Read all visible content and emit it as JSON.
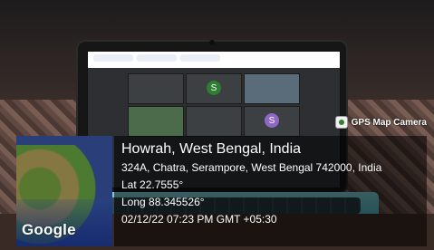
{
  "overlay": {
    "badge": {
      "text": "GPS Map Camera",
      "icon": "gps-map-camera-icon"
    },
    "map": {
      "brand_text": "Google"
    },
    "location": {
      "title": "Howrah, West Bengal, India",
      "address": "324A, Chatra, Serampore, West Bengal 742000, India",
      "lat": "Lat 22.7555°",
      "long": "Long 88.345526°",
      "timestamp": "02/12/22 07:23 PM GMT +05:30"
    }
  },
  "screen": {
    "tiles": [
      {
        "kind": "avatar",
        "label": "S",
        "color": "#2e7d32"
      },
      {
        "kind": "avatar",
        "label": "S",
        "color": "#8e67c7"
      }
    ]
  }
}
